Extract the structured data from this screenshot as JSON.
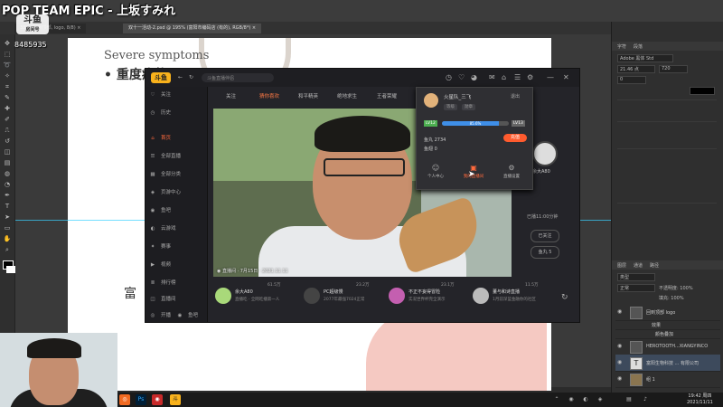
{
  "stream": {
    "title": "POP TEAM EPIC - 上坂すみれ",
    "badge_main": "斗鱼",
    "badge_sub": "直播",
    "room_id": "8485935",
    "room_label": "房间号"
  },
  "photoshop": {
    "doc_tabs": [
      "33%  (回到顶部, logo, 8/8) ×",
      "双十一活动-2.psd @ 195% (富阳市编码店 (有的), RGB/8*) ×"
    ],
    "document": {
      "heading": "Severe symptoms",
      "subheading": "• 重度症状",
      "bottom_text": "富"
    },
    "right_panel": {
      "sections": [
        "字符",
        "段落",
        "图层",
        "通道",
        "路径"
      ],
      "font_name": "Adobe 黑体 Std",
      "font_size": "21.46 点",
      "tracking": "0",
      "leading": "720",
      "layer_kind": "类型",
      "blend_mode": "正常",
      "opacity": "不透明度: 100%",
      "fill": "填充: 100%",
      "layers": [
        "回到顶部 logo",
        "效果",
        "颜色叠加",
        "HEROTOOTH...XIANGYINCO",
        "富阳生物科技 ... 有限公司",
        "组 1"
      ]
    }
  },
  "douyu": {
    "window_title": "斗鱼直播伴侣",
    "sidebar": [
      {
        "icon": "♡",
        "label": "关注"
      },
      {
        "icon": "◷",
        "label": "历史"
      },
      {
        "icon": "⌂",
        "label": "首页",
        "active": true
      },
      {
        "icon": "☰",
        "label": "全部直播"
      },
      {
        "icon": "▦",
        "label": "全部分类"
      },
      {
        "icon": "◈",
        "label": "页游中心"
      },
      {
        "icon": "◉",
        "label": "鱼吧"
      },
      {
        "icon": "◐",
        "label": "云游戏"
      },
      {
        "icon": "✦",
        "label": "赛事"
      },
      {
        "icon": "▶",
        "label": "视频"
      },
      {
        "icon": "≣",
        "label": "排行榜"
      },
      {
        "icon": "◫",
        "label": "直播间"
      }
    ],
    "sidebar_footer": [
      "开播",
      "鱼吧"
    ],
    "categories": [
      "关注",
      "猜你喜欢",
      "和平精英",
      "绝地求生",
      "王者荣耀"
    ],
    "video_caption": "◉ 直播间 · 7月15日 · 2021.11.11",
    "right_name": "余大A80",
    "right_status": "已播11:00分钟",
    "right_buttons": [
      "已关注",
      "鱼丸 5"
    ],
    "popup": {
      "name": "火星队_三飞",
      "logout": "退出",
      "tags": [
        "等级",
        "勋章"
      ],
      "level_left": "LV12",
      "level_right": "LV13",
      "progress": 0.85,
      "progress_text": "85.6%",
      "yuwan": "鱼丸 2734",
      "yuchi": "鱼翅 0",
      "recharge": "充值",
      "actions": [
        {
          "icon": "☺",
          "label": "个人中心"
        },
        {
          "icon": "▣",
          "label": "我的直播间"
        },
        {
          "icon": "⚙",
          "label": "直播设置"
        }
      ]
    },
    "recommendations": [
      {
        "name": "余大A80",
        "desc": "直播吃 · 全网吃播第一人",
        "heat": "61.5万"
      },
      {
        "name": "PC超级慢",
        "desc": "2077年最强7024正常",
        "heat": "23.2万"
      },
      {
        "name": "不正不妄得冒险",
        "desc": "实况世界杯完全演示",
        "heat": "23.1万"
      },
      {
        "name": "董与和诗直播",
        "desc": "1月前深蓝金融你的社区",
        "heat": "11.5万"
      }
    ]
  },
  "taskbar": {
    "time": "19:42  周四",
    "date": "2021/11/11"
  },
  "colors": {
    "douyu_orange": "#ff6a3d",
    "douyu_logo": "#f9b21c",
    "guide_cyan": "#39d0ff",
    "progress_blue": "#3f8fe8"
  }
}
